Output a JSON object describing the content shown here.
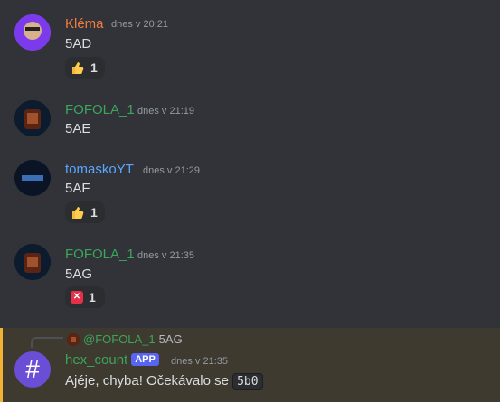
{
  "messages": [
    {
      "username": "Kléma",
      "color": "#f47b3e",
      "time": "dnes v 20:21",
      "text": "5AD",
      "reaction": {
        "emoji": "thumbs-up",
        "count": "1"
      }
    },
    {
      "username": "FOFOLA_1",
      "color": "#3ba55c",
      "time": "dnes v 21:19",
      "text": "5AE"
    },
    {
      "username": "tomaskoYT",
      "color": "#5aa6ff",
      "time": "dnes v 21:29",
      "text": "5AF",
      "reaction": {
        "emoji": "thumbs-up",
        "count": "1"
      }
    },
    {
      "username": "FOFOLA_1",
      "color": "#3ba55c",
      "time": "dnes v 21:35",
      "text": "5AG",
      "reaction": {
        "emoji": "cross-mark",
        "count": "1"
      }
    }
  ],
  "bot_message": {
    "reply_mention": "@FOFOLA_1",
    "reply_text": "5AG",
    "username": "hex_count",
    "tag": "APP",
    "time": "dnes v 21:35",
    "text": "Ajéje, chyba! Očekávalo se",
    "code": "5b0"
  }
}
